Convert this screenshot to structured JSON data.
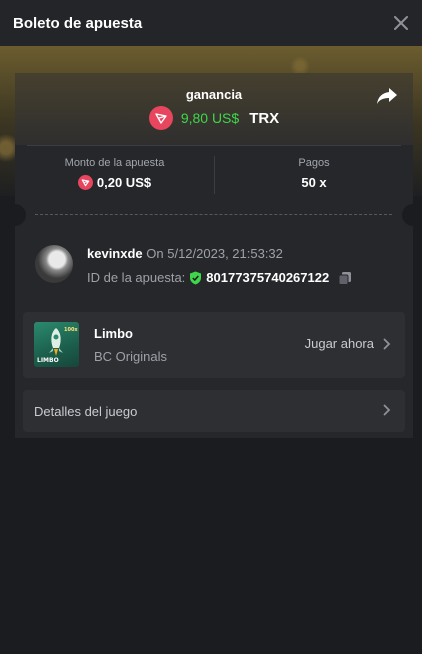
{
  "header": {
    "title": "Boleto de apuesta"
  },
  "ticket": {
    "gain_label": "ganancia",
    "gain_amount": "9,80 US$",
    "gain_currency": "TRX",
    "bet_amount_label": "Monto de la apuesta",
    "bet_amount_value": "0,20 US$",
    "payout_label": "Pagos",
    "payout_value": "50 x"
  },
  "user": {
    "name": "kevinxde",
    "date": "On 5/12/2023, 21:53:32",
    "bet_id_label": "ID de la apuesta:",
    "bet_id": "80177375740267122"
  },
  "game": {
    "name": "Limbo",
    "provider": "BC Originals",
    "play_label": "Jugar ahora",
    "thumb_text": "LIMBO",
    "thumb_badge": "100x"
  },
  "details": {
    "label": "Detalles del juego"
  },
  "colors": {
    "accent_green": "#3fd64a",
    "trx_red": "#e8465e",
    "panel": "#25272b"
  },
  "icons": [
    "close-icon",
    "trx-coin-icon",
    "share-icon",
    "shield-check-icon",
    "copy-icon",
    "chevron-right-icon"
  ]
}
